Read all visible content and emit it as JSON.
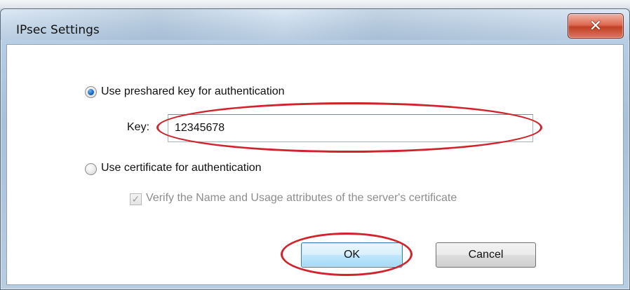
{
  "window": {
    "title": "IPsec Settings",
    "close_glyph": "✕"
  },
  "auth": {
    "preshared_option_label": "Use preshared key for authentication",
    "preshared_selected": true,
    "key_label": "Key:",
    "key_value": "12345678",
    "certificate_option_label": "Use certificate for authentication",
    "certificate_selected": false,
    "verify_label": "Verify the Name and Usage attributes of the server's certificate",
    "verify_checked": true,
    "verify_enabled": false
  },
  "buttons": {
    "ok_label": "OK",
    "cancel_label": "Cancel"
  },
  "highlight_color": "#d1232b"
}
